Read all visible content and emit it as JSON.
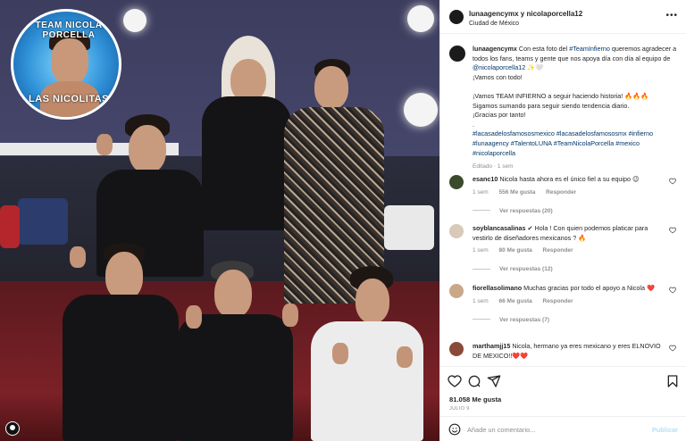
{
  "photo": {
    "badge_top_text": "TEAM NICOLA PORCELLA",
    "badge_bottom_text": "LAS NICOLITAS"
  },
  "post": {
    "header_user": "lunaagencymx y nicolaporcella12",
    "location": "Ciudad de México",
    "caption": {
      "user": "lunaagencymx",
      "text_1": " Con esta foto del ",
      "tag_teaminfierno": "#TeamInfierno",
      "text_2": " queremos agradecer a todos los fans, teams y gente que nos apoya día con día al equipo de ",
      "mention": "@nicolaporcella12",
      "text_3": " ✨🤍",
      "line_vamos": "¡Vamos con todo!",
      "line_team": "¡Vamos TEAM INFIERNO a seguir haciendo historia! 🔥🔥🔥",
      "line_sigamos": "Sigamos sumando para seguir siendo tendencia diario.",
      "line_gracias": "¡Gracias por tanto!",
      "dot": ".",
      "hashtags": "#lacasadelosfamososmexico #lacasadelosfamososmx #infierno #lunaagency #TalentoLUNA #TeamNicolaPorcella #mexico #nicolaporcella",
      "meta": "Editado · 1 sem"
    },
    "comments": [
      {
        "user": "esanc10",
        "text": " Nicola hasta ahora es el único fiel a su equipo 😉",
        "time": "1 sem",
        "likes": "556 Me gusta",
        "reply": "Responder",
        "replies": "Ver respuestas (20)"
      },
      {
        "user": "soyblancasalinas",
        "text": " ✔ Hola ! Con quien podemos platicar para vestirlo de diseñadores mexicanos ? 🔥",
        "time": "1 sem",
        "likes": "80 Me gusta",
        "reply": "Responder",
        "replies": "Ver respuestas (12)"
      },
      {
        "user": "fiorellasolimano",
        "text": " Muchas gracias por todo el apoyo a Nicola ❤️",
        "time": "1 sem",
        "likes": "66 Me gusta",
        "reply": "Responder",
        "replies": "Ver respuestas (7)"
      },
      {
        "user": "marthamjj15",
        "text": " Nicola, hermano ya eres mexicano y eres ELNOVIO DE MEXICO!!❤️❤️",
        "time": "",
        "likes": "",
        "reply": "",
        "replies": ""
      }
    ],
    "likes": "81.058 Me gusta",
    "date": "JULIO 9",
    "add_comment_placeholder": "Añade un comentario...",
    "publish": "Publicar"
  }
}
